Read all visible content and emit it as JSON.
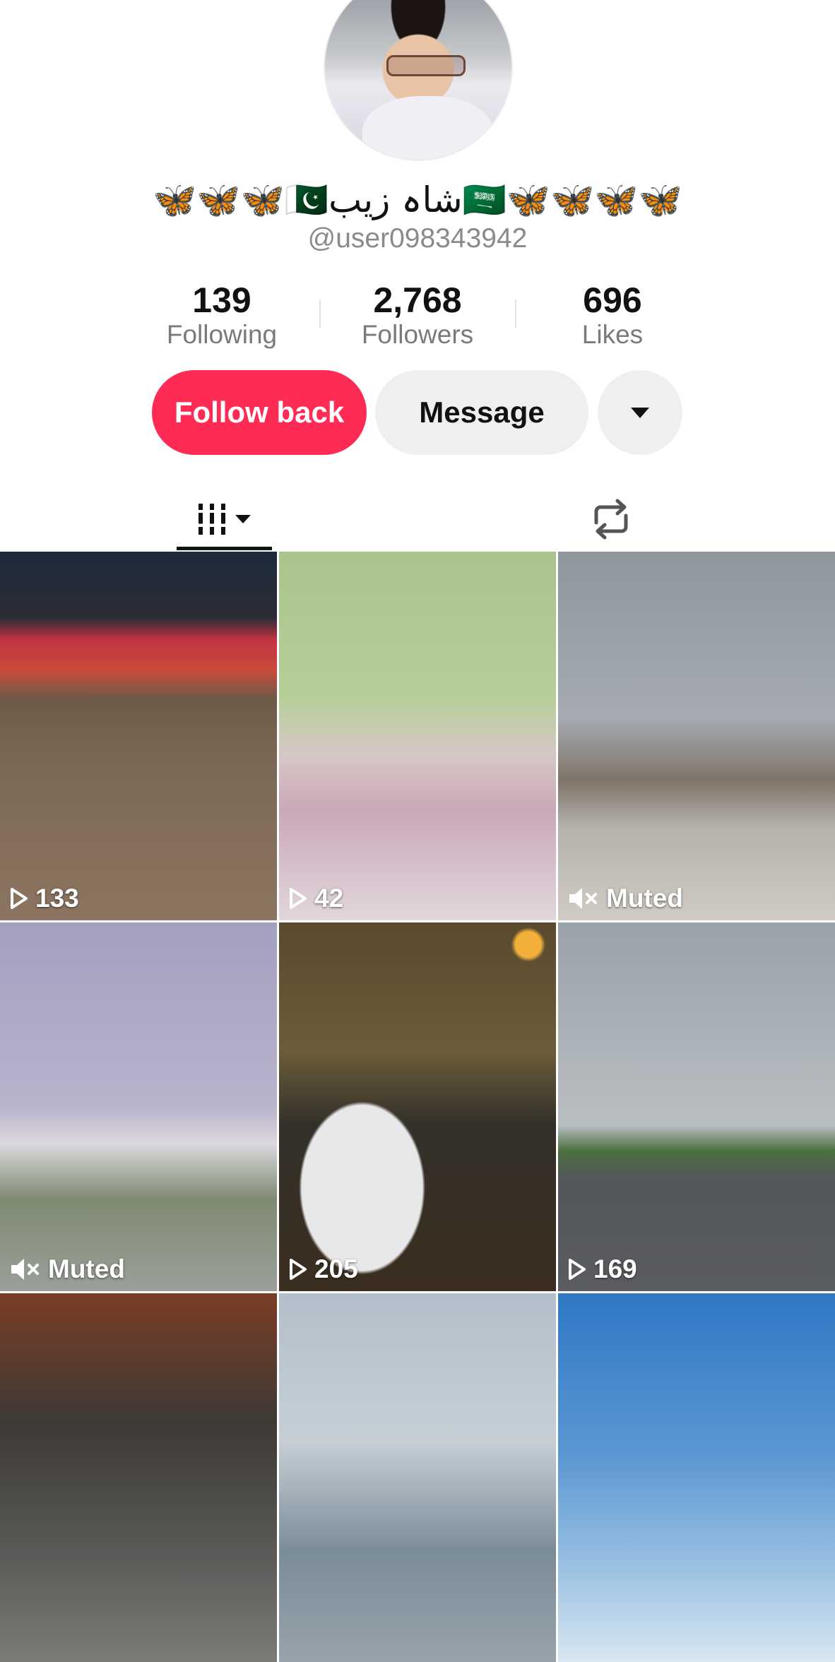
{
  "profile": {
    "display_name": "🦋🦋🦋🇵🇰شاہ زیب🇸🇦🦋🦋🦋🦋",
    "handle": "@user098343942"
  },
  "stats": [
    {
      "value": "139",
      "label": "Following"
    },
    {
      "value": "2,768",
      "label": "Followers"
    },
    {
      "value": "696",
      "label": "Likes"
    }
  ],
  "actions": {
    "follow_back": "Follow back",
    "message": "Message",
    "more_icon": "caret-down-icon"
  },
  "tabs": {
    "videos_icon": "grid-videos-icon",
    "repost_icon": "repost-icon"
  },
  "videos": [
    {
      "type": "views",
      "text": "133"
    },
    {
      "type": "views",
      "text": "42"
    },
    {
      "type": "muted",
      "text": "Muted"
    },
    {
      "type": "muted",
      "text": "Muted"
    },
    {
      "type": "views",
      "text": "205"
    },
    {
      "type": "views",
      "text": "169"
    },
    {
      "type": "none",
      "text": ""
    },
    {
      "type": "none",
      "text": ""
    },
    {
      "type": "none",
      "text": ""
    }
  ]
}
